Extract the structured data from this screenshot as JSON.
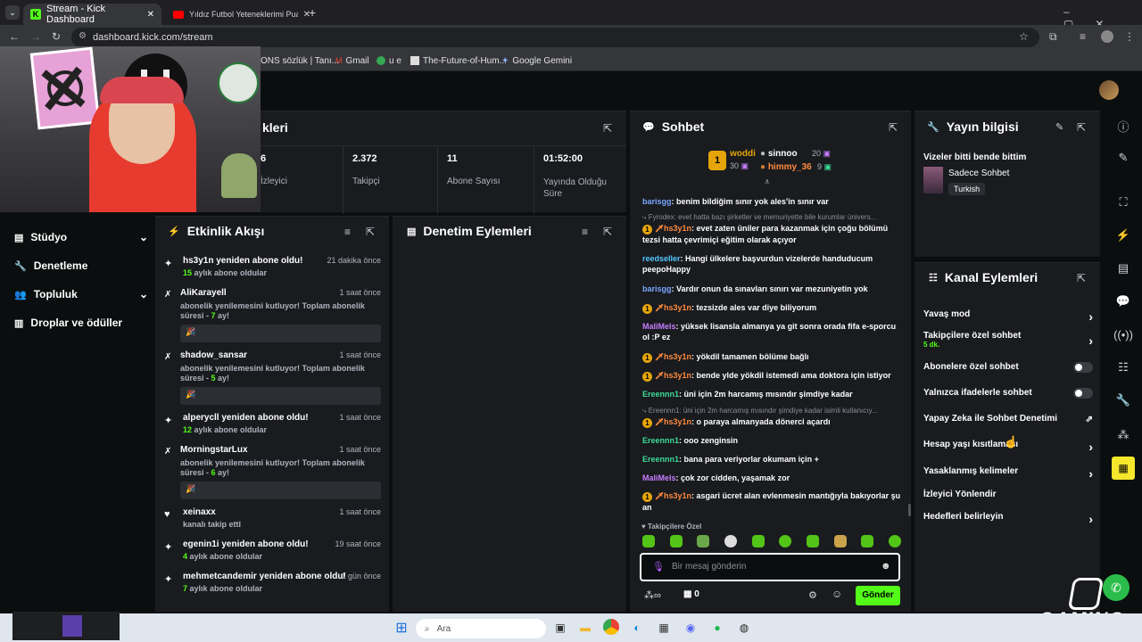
{
  "browser": {
    "tabs": [
      {
        "title": "Stream - Kick Dashboard",
        "favicon": "kick-icon",
        "active": true
      },
      {
        "title": "Yıldız Futbol Yeteneklerimi Pua...",
        "favicon": "youtube-icon",
        "active": false
      }
    ],
    "url": "dashboard.kick.com/stream",
    "bookmarks": [
      {
        "label": "ONS sözlük | Tanı..."
      },
      {
        "label": "Gmail"
      },
      {
        "label": "u e"
      },
      {
        "label": "The-Future-of-Hum..."
      },
      {
        "label": "Google Gemini"
      }
    ]
  },
  "sidebar": {
    "items": [
      {
        "label": "Stüdyo",
        "icon": "studio-icon",
        "expandable": true
      },
      {
        "label": "Denetleme",
        "icon": "wrench-icon",
        "expandable": false
      },
      {
        "label": "Topluluk",
        "icon": "community-icon",
        "expandable": true
      },
      {
        "label": "Droplar ve ödüller",
        "icon": "drops-icon",
        "expandable": false
      }
    ]
  },
  "stats": {
    "title": "kleri",
    "items": [
      {
        "value": "6",
        "label": "İzleyici"
      },
      {
        "value": "2.372",
        "label": "Takipçi"
      },
      {
        "value": "11",
        "label": "Abone Sayısı"
      },
      {
        "value": "01:52:00",
        "label": "Yayında Olduğu Süre"
      }
    ]
  },
  "events": {
    "title": "Etkinlik Akışı",
    "items": [
      {
        "title": "hs3y1n yeniden abone oldu!",
        "time": "21 dakika önce",
        "sub_num": "15",
        "sub_text": "aylık abone oldular",
        "type": "resub"
      },
      {
        "title": "AliKarayell",
        "time": "1 saat önce",
        "msg": "abonelik yenilemesini kutluyor! Toplam abonelik süresi - ",
        "msg_num": "7",
        "msg_tail": "ay!",
        "type": "gift",
        "box": "🎉"
      },
      {
        "title": "shadow_sansar",
        "time": "1 saat önce",
        "msg": "abonelik yenilemesini kutluyor! Toplam abonelik süresi - ",
        "msg_num": "5",
        "msg_tail": "ay!",
        "type": "gift",
        "box": "🎉"
      },
      {
        "title": "alperycll yeniden abone oldu!",
        "time": "1 saat önce",
        "sub_num": "12",
        "sub_text": "aylık abone oldular",
        "type": "resub"
      },
      {
        "title": "MorningstarLux",
        "time": "1 saat önce",
        "msg": "abonelik yenilemesini kutluyor! Toplam abonelik süresi - ",
        "msg_num": "6",
        "msg_tail": "ay!",
        "type": "gift",
        "box": "🎉"
      },
      {
        "title": "xeinaxx",
        "time": "1 saat önce",
        "sub_text": "kanalı takip etti",
        "type": "follow"
      },
      {
        "title": "egenin1i yeniden abone oldu!",
        "time": "19 saat önce",
        "sub_num": "4",
        "sub_text": "aylık abone oldular",
        "type": "resub"
      },
      {
        "title": "mehmetcandemir yeniden abone oldu!",
        "time": "1 gün önce",
        "sub_num": "7",
        "sub_text": "aylık abone oldular",
        "type": "resub"
      }
    ]
  },
  "moderation": {
    "title": "Denetim Eylemleri"
  },
  "chat": {
    "title": "Sohbet",
    "leaders": [
      {
        "name": "woddi",
        "count": "30"
      },
      {
        "name": "sinnoo",
        "count": "20"
      },
      {
        "name": "himmy_36",
        "count": "9"
      }
    ],
    "messages": [
      {
        "user": "barisgg",
        "color": "#7aa7ff",
        "text": "benim bildiğim sınır yok ales'in sınır var"
      },
      {
        "reply": "Fyrodex: evet hatta bazı şirketler ve memuriyette bile kurumlar ünivers..."
      },
      {
        "user": "hs3y1n",
        "color": "#ff8a3d",
        "badge": "1",
        "text": "evet zaten üniler para kazanmak için çoğu bölümü tezsi hatta çevrimiçi eğitim olarak açıyor"
      },
      {
        "user": "reedseller",
        "color": "#53c7ff",
        "text": "Hangi ülkelere başvurdun vizelerde handuducum peepoHappy"
      },
      {
        "user": "barisgg",
        "color": "#7aa7ff",
        "text": "Vardır onun da sınavları sınırı var mezuniyetin yok"
      },
      {
        "user": "hs3y1n",
        "color": "#ff8a3d",
        "badge": "1",
        "text": "tezsizde ales var diye biliyorum"
      },
      {
        "user": "MaliMels",
        "color": "#c77dff",
        "text": "yüksek lisansla almanya ya git sonra orada fifa e-sporcu ol :P ez"
      },
      {
        "user": "hs3y1n",
        "color": "#ff8a3d",
        "badge": "1",
        "text": "yökdil tamamen bölüme bağlı"
      },
      {
        "user": "hs3y1n",
        "color": "#ff8a3d",
        "badge": "1",
        "text": "bende ylde yökdil istemedi ama doktora için istiyor"
      },
      {
        "user": "Ereennn1",
        "color": "#3ddc97",
        "text": "üni için 2m harcamış mısındır şimdiye kadar"
      },
      {
        "reply": "Ereennn1: üni için 2m harcamış mısındır şimdiye kadar isimli kullanıcıy..."
      },
      {
        "user": "hs3y1n",
        "color": "#ff8a3d",
        "badge": "1",
        "text": "o paraya almanyada dönerci açardı"
      },
      {
        "user": "Ereennn1",
        "color": "#3ddc97",
        "text": "ooo zenginsin"
      },
      {
        "user": "Ereennn1",
        "color": "#3ddc97",
        "text": "bana para veriyorlar okumam için +"
      },
      {
        "user": "MaliMels",
        "color": "#c77dff",
        "text": "çok zor cidden, yaşamak zor"
      },
      {
        "user": "hs3y1n",
        "color": "#ff8a3d",
        "badge": "1",
        "text": "asgari ücret alan evlenmesin mantığıyla bakıyorlar şu an"
      }
    ],
    "followers_only": "Takipçilere Özel",
    "input_placeholder": "Bir mesaj gönderin",
    "points": "0",
    "send_label": "Gönder"
  },
  "stream_info": {
    "title": "Yayın bilgisi",
    "stream_title": "Vizeler bitti bende bittim",
    "category": "Sadece Sohbet",
    "language": "Turkish"
  },
  "channel_actions": {
    "title": "Kanal Eylemleri",
    "items": [
      {
        "label": "Yavaş mod",
        "control": "chevron"
      },
      {
        "label": "Takipçilere özel sohbet",
        "sub": "5 dk.",
        "control": "chevron"
      },
      {
        "label": "Abonelere özel sohbet",
        "control": "toggle"
      },
      {
        "label": "Yalnızca ifadelerle sohbet",
        "control": "toggle"
      },
      {
        "label": "Yapay Zeka ile Sohbet Denetimi",
        "control": "external"
      },
      {
        "label": "Hesap yaşı kısıtlaması",
        "control": "chevron"
      },
      {
        "label": "Yasaklanmış kelimeler",
        "control": "chevron"
      },
      {
        "label": "İzleyici Yönlendir",
        "control": "none"
      },
      {
        "label": "Hedefleri belirleyin",
        "control": "chevron"
      }
    ]
  },
  "taskbar": {
    "search_placeholder": "Ara",
    "brand": "GAMING"
  },
  "colors": {
    "accent": "#53fc18",
    "panel": "#191b1f",
    "background": "#0b0e0f"
  }
}
